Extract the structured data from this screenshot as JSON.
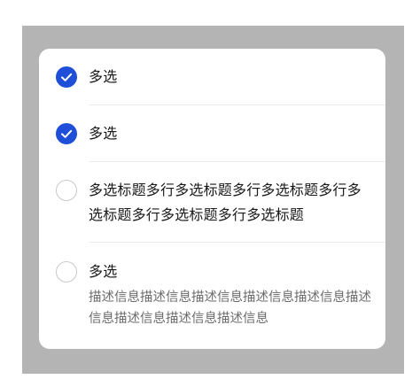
{
  "options": [
    {
      "title": "多选",
      "checked": true
    },
    {
      "title": "多选",
      "checked": true
    },
    {
      "title": "多选标题多行多选标题多行多选标题多行多选标题多行多选标题多行多选标题",
      "checked": false
    },
    {
      "title": "多选",
      "description": "描述信息描述信息描述信息描述信息描述信息描述信息描述信息描述信息描述信息",
      "checked": false
    }
  ],
  "colors": {
    "accent": "#1f4fd8",
    "backdrop": "#b4b4b4",
    "divider": "#ebebeb"
  },
  "icons": {
    "checked": "check-circle-icon",
    "unchecked": "empty-circle-icon"
  }
}
